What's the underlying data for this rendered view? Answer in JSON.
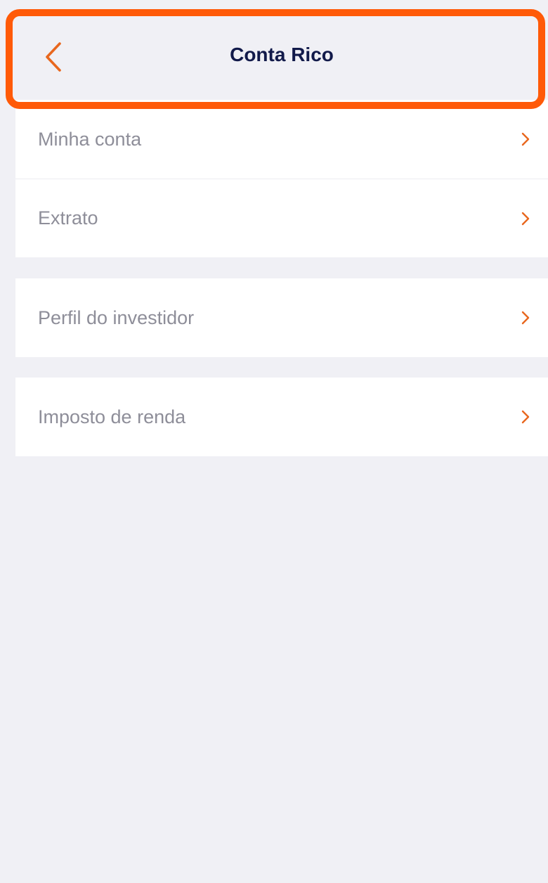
{
  "header": {
    "title": "Conta Rico",
    "back_icon": "chevron-left-icon"
  },
  "menu": {
    "items": [
      {
        "label": "Minha conta"
      },
      {
        "label": "Extrato"
      },
      {
        "label": "Perfil do investidor"
      },
      {
        "label": "Imposto de renda"
      }
    ],
    "item_icon": "chevron-right-icon"
  },
  "colors": {
    "accent": "#e8671e",
    "highlight": "#ff5a08",
    "title": "#121a4a",
    "label": "#8e8e99",
    "background": "#f0f0f5",
    "surface": "#ffffff"
  }
}
